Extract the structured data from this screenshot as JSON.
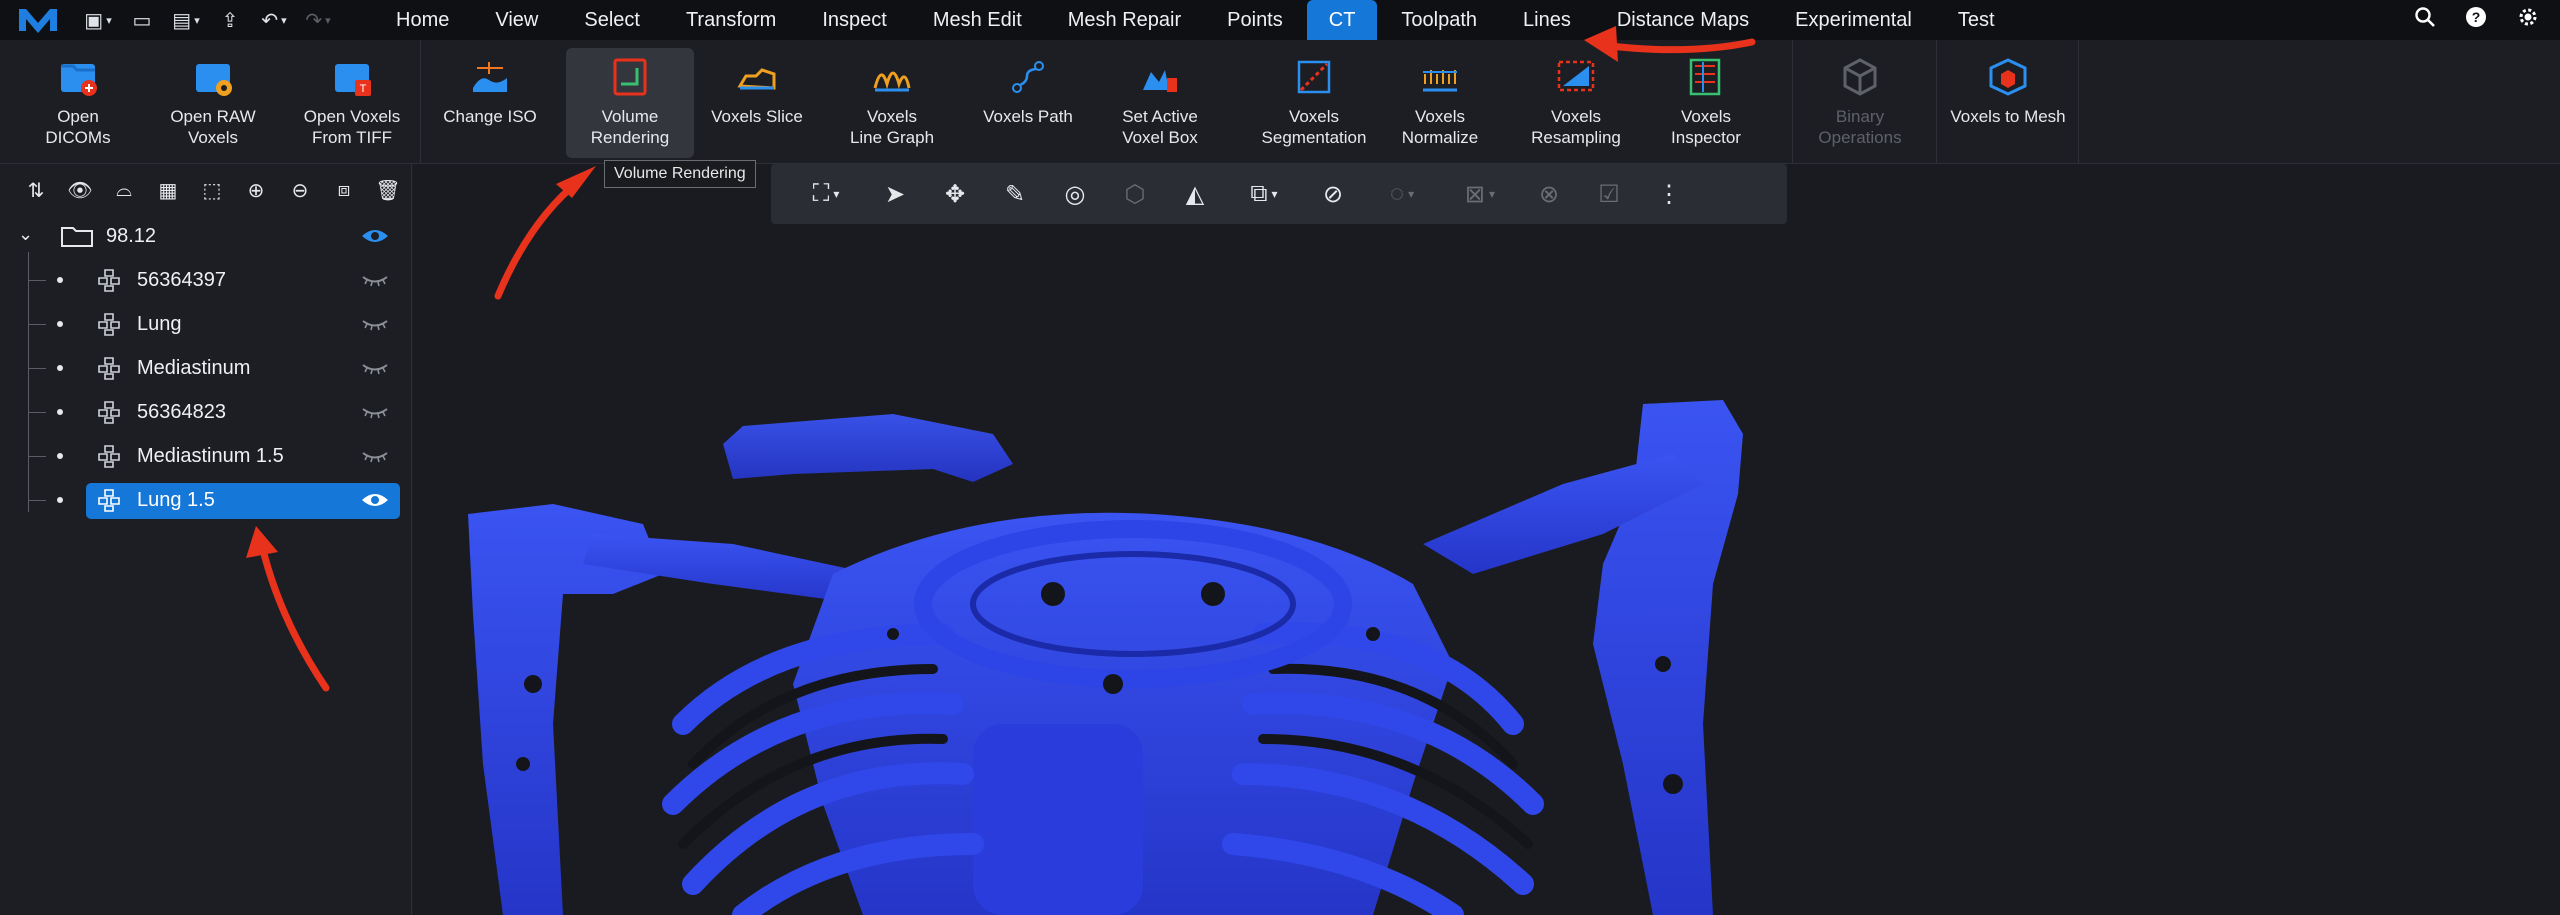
{
  "menubar": {
    "logo": "app-logo",
    "quick_actions": [
      {
        "name": "new-file-icon",
        "glyph": "▣",
        "caret": true
      },
      {
        "name": "open-folder-icon",
        "glyph": "▭"
      },
      {
        "name": "save-icon",
        "glyph": "▤",
        "caret": true
      },
      {
        "name": "export-icon",
        "glyph": "⇪"
      },
      {
        "name": "undo-icon",
        "glyph": "↶",
        "caret": true
      },
      {
        "name": "redo-icon",
        "glyph": "↷",
        "caret": true,
        "disabled": true
      }
    ],
    "menus": [
      "Home",
      "View",
      "Select",
      "Transform",
      "Inspect",
      "Mesh Edit",
      "Mesh Repair",
      "Points",
      "CT",
      "Toolpath",
      "Lines",
      "Distance Maps",
      "Experimental",
      "Test"
    ],
    "active_menu": "CT",
    "right_icons": [
      "search-icon",
      "help-icon",
      "settings-icon"
    ]
  },
  "ribbon": {
    "buttons": [
      {
        "label": "Open DICOMs",
        "icon": "open-dicoms-icon"
      },
      {
        "label": "Open RAW\nVoxels",
        "icon": "open-raw-voxels-icon"
      },
      {
        "label": "Open Voxels\nFrom TIFF",
        "icon": "open-voxels-tiff-icon"
      },
      {
        "label": "Change ISO",
        "icon": "change-iso-icon"
      },
      {
        "label": "Volume\nRendering",
        "icon": "volume-rendering-icon"
      },
      {
        "label": "Voxels Slice",
        "icon": "voxels-slice-icon"
      },
      {
        "label": "Voxels\nLine Graph",
        "icon": "voxels-line-graph-icon"
      },
      {
        "label": "Voxels Path",
        "icon": "voxels-path-icon"
      },
      {
        "label": "Set Active\nVoxel Box",
        "icon": "set-active-voxel-box-icon"
      },
      {
        "label": "Voxels\nSegmentation",
        "icon": "voxels-segmentation-icon"
      },
      {
        "label": "Voxels\nNormalize",
        "icon": "voxels-normalize-icon"
      },
      {
        "label": "Voxels\nResampling",
        "icon": "voxels-resampling-icon"
      },
      {
        "label": "Voxels\nInspector",
        "icon": "voxels-inspector-icon"
      },
      {
        "label": "Binary\nOperations",
        "icon": "binary-operations-icon",
        "disabled": true
      },
      {
        "label": "Voxels to Mesh",
        "icon": "voxels-to-mesh-icon"
      }
    ],
    "hovered": "Volume\nRendering",
    "tooltip": "Volume Rendering"
  },
  "scene_tree": {
    "toolbar": [
      "sort-az-icon",
      "show-icon",
      "hide-icon",
      "select-all-icon",
      "deselect-icon",
      "move-up-icon",
      "move-down-icon",
      "flip-icon",
      "delete-icon"
    ],
    "root": {
      "label": "98.12",
      "visible": true,
      "expanded": true
    },
    "items": [
      {
        "label": "56364397",
        "visible": false,
        "selected": false
      },
      {
        "label": "Lung",
        "visible": false,
        "selected": false
      },
      {
        "label": "Mediastinum",
        "visible": false,
        "selected": false
      },
      {
        "label": "56364823",
        "visible": false,
        "selected": false
      },
      {
        "label": "Mediastinum 1.5",
        "visible": false,
        "selected": false
      },
      {
        "label": "Lung 1.5",
        "visible": true,
        "selected": true
      }
    ]
  },
  "viewport": {
    "toolbar": [
      {
        "name": "fit-view-icon",
        "glyph": "⛶",
        "caret": true
      },
      {
        "name": "select-cursor-icon",
        "glyph": "➤"
      },
      {
        "name": "move-icon",
        "glyph": "✥"
      },
      {
        "name": "edit-shape-icon",
        "glyph": "✎"
      },
      {
        "name": "section-icon",
        "glyph": "◎"
      },
      {
        "name": "transform-disabled-icon",
        "glyph": "⬡",
        "disabled": true
      },
      {
        "name": "shapes-icon",
        "glyph": "◭"
      },
      {
        "name": "boolean-icon",
        "glyph": "⧉",
        "caret": true
      },
      {
        "name": "no-shading-icon",
        "glyph": "⊘"
      },
      {
        "name": "lasso-icon",
        "glyph": "◌",
        "caret": true,
        "disabled": true
      },
      {
        "name": "clear-selection-icon",
        "glyph": "⊠",
        "caret": true,
        "disabled": true
      },
      {
        "name": "disabled-target-icon",
        "glyph": "⊗",
        "disabled": true
      },
      {
        "name": "confirm-icon",
        "glyph": "☑",
        "disabled": true
      },
      {
        "name": "more-options-icon",
        "glyph": "⋮"
      }
    ],
    "model_color": "#3349e8",
    "background": "#1a1b20"
  },
  "colors": {
    "accent": "#1577d8",
    "annotation": "#e8321c"
  }
}
